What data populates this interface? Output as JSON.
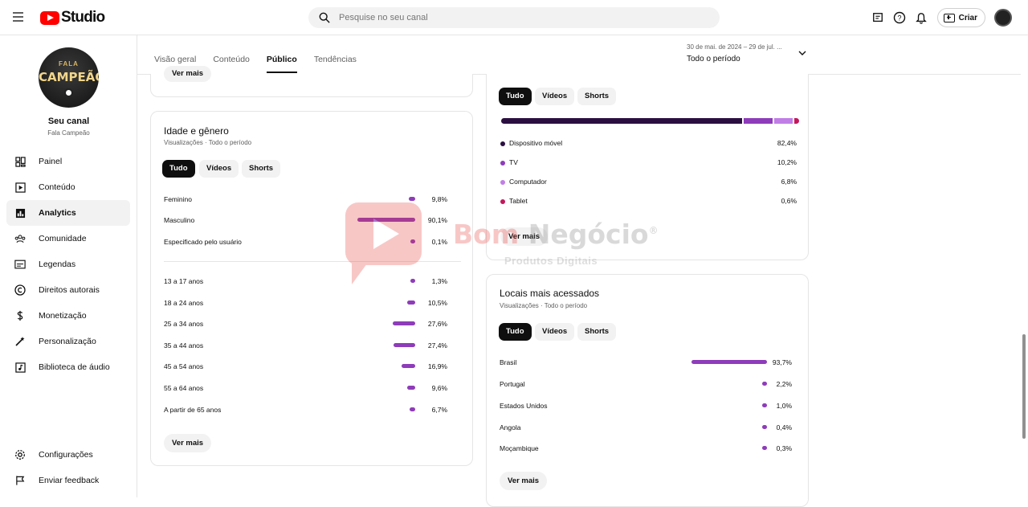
{
  "header": {
    "logo_text": "Studio",
    "search_placeholder": "Pesquise no seu canal",
    "create_label": "Criar",
    "icons": [
      "feedback-icon",
      "help-icon",
      "notifications-icon"
    ]
  },
  "channel": {
    "title": "Seu canal",
    "name": "Fala Campeão",
    "avatar_line1": "FALA",
    "avatar_line2": "CAMPEÃO"
  },
  "sidebar": {
    "items": [
      {
        "label": "Painel",
        "icon": "dashboard-icon"
      },
      {
        "label": "Conteúdo",
        "icon": "content-icon"
      },
      {
        "label": "Analytics",
        "icon": "analytics-icon",
        "active": true
      },
      {
        "label": "Comunidade",
        "icon": "community-icon"
      },
      {
        "label": "Legendas",
        "icon": "subtitles-icon"
      },
      {
        "label": "Direitos autorais",
        "icon": "copyright-icon"
      },
      {
        "label": "Monetização",
        "icon": "monetization-icon"
      },
      {
        "label": "Personalização",
        "icon": "customization-icon"
      },
      {
        "label": "Biblioteca de áudio",
        "icon": "audio-library-icon"
      }
    ],
    "bottom": [
      {
        "label": "Configurações",
        "icon": "settings-icon"
      },
      {
        "label": "Enviar feedback",
        "icon": "send-feedback-icon"
      }
    ]
  },
  "tabs": [
    "Visão geral",
    "Conteúdo",
    "Público",
    "Tendências"
  ],
  "active_tab": "Público",
  "date_range": {
    "range": "30 de mai. de 2024 – 29 de jul. ...",
    "label": "Todo o período"
  },
  "top_card": {
    "see_more": "Ver mais"
  },
  "age_gender": {
    "title": "Idade e gênero",
    "subtitle": "Visualizações · Todo o período",
    "chips": [
      "Tudo",
      "Vídeos",
      "Shorts"
    ],
    "gender": [
      {
        "label": "Feminino",
        "value": "9,8%",
        "pct": 9.8
      },
      {
        "label": "Masculino",
        "value": "90,1%",
        "pct": 90.1
      },
      {
        "label": "Especificado pelo usuário",
        "value": "0,1%",
        "pct": 0.1
      }
    ],
    "ages": [
      {
        "label": "13 a 17 anos",
        "value": "1,3%",
        "pct": 1.3
      },
      {
        "label": "18 a 24 anos",
        "value": "10,5%",
        "pct": 10.5
      },
      {
        "label": "25 a 34 anos",
        "value": "27,6%",
        "pct": 27.6
      },
      {
        "label": "35 a 44 anos",
        "value": "27,4%",
        "pct": 27.4
      },
      {
        "label": "45 a 54 anos",
        "value": "16,9%",
        "pct": 16.9
      },
      {
        "label": "55 a 64 anos",
        "value": "9,6%",
        "pct": 9.6
      },
      {
        "label": "A partir de 65 anos",
        "value": "6,7%",
        "pct": 6.7
      }
    ],
    "see_more": "Ver mais"
  },
  "devices": {
    "chips": [
      "Tudo",
      "Vídeos",
      "Shorts"
    ],
    "items": [
      {
        "label": "Dispositivo móvel",
        "value": "82,4%",
        "pct": 82.4,
        "color": "#2a0f40"
      },
      {
        "label": "TV",
        "value": "10,2%",
        "pct": 10.2,
        "color": "#8e3cba"
      },
      {
        "label": "Computador",
        "value": "6,8%",
        "pct": 6.8,
        "color": "#c07ee6"
      },
      {
        "label": "Tablet",
        "value": "0,6%",
        "pct": 0.6,
        "color": "#c2185b"
      }
    ],
    "see_more": "Ver mais"
  },
  "locations": {
    "title": "Locais mais acessados",
    "subtitle": "Visualizações · Todo o período",
    "chips": [
      "Tudo",
      "Vídeos",
      "Shorts"
    ],
    "items": [
      {
        "label": "Brasil",
        "value": "93,7%",
        "pct": 93.7
      },
      {
        "label": "Portugal",
        "value": "2,2%",
        "pct": 2.2
      },
      {
        "label": "Estados Unidos",
        "value": "1,0%",
        "pct": 1.0
      },
      {
        "label": "Angola",
        "value": "0,4%",
        "pct": 0.4
      },
      {
        "label": "Moçambique",
        "value": "0,3%",
        "pct": 0.3
      }
    ],
    "see_more": "Ver mais"
  },
  "watermark": {
    "word1": "Bom",
    "word2": "Negócio",
    "mark": "®",
    "subtitle": "Produtos Digitais"
  },
  "colors": {
    "bar": "#8e3cba",
    "selected_chip": "#0f0f0f",
    "brand_red": "#ff0000"
  }
}
